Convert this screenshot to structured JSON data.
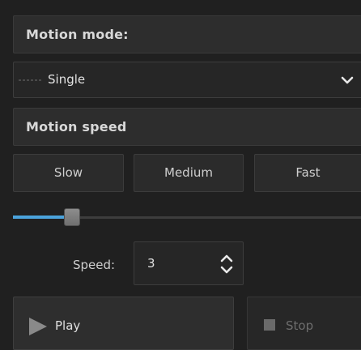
{
  "motion_mode": {
    "title": "Motion mode:",
    "selected": "Single",
    "icons": [
      "dashed-line-icon",
      "chevron-down-icon"
    ]
  },
  "motion_speed": {
    "title": "Motion speed",
    "presets": [
      "Slow",
      "Medium",
      "Fast"
    ]
  },
  "slider": {
    "value_fraction": 0.17,
    "accent_color": "#4ba3dc"
  },
  "speed": {
    "label": "Speed:",
    "value": "3"
  },
  "controls": {
    "play_label": "Play",
    "stop_label": "Stop",
    "stop_enabled": false,
    "icons": [
      "play-icon",
      "stop-icon"
    ]
  }
}
